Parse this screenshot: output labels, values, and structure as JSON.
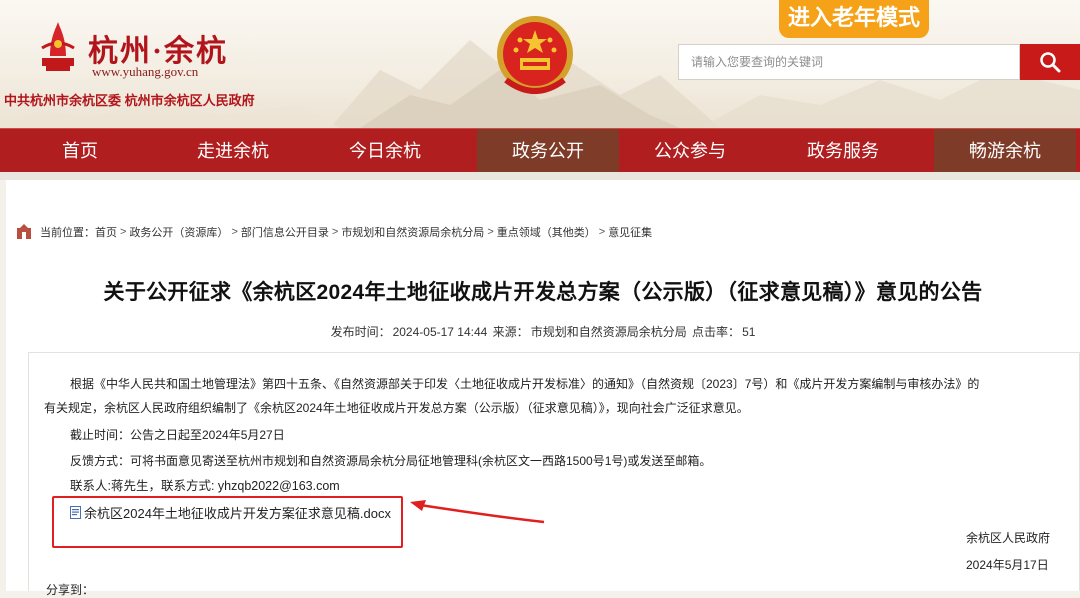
{
  "header": {
    "logo_title": "杭州·余杭",
    "logo_url": "www.yuhang.gov.cn",
    "logo_sub": "中共杭州市余杭区委 杭州市余杭区人民政府",
    "elder_mode": "进入老年模式",
    "search_placeholder": "请输入您要查询的关键词"
  },
  "nav": {
    "items": [
      "首页",
      "走进余杭",
      "今日余杭",
      "政务公开",
      "公众参与",
      "政务服务",
      "畅游余杭"
    ],
    "active": "政务公开"
  },
  "breadcrumb": {
    "prefix": "当前位置：",
    "items": [
      "首页",
      "政务公开（资源库）",
      "部门信息公开目录",
      "市规划和自然资源局余杭分局",
      "重点领域（其他类）",
      "意见征集"
    ],
    "separator": ">"
  },
  "article": {
    "title": "关于公开征求《余杭区2024年土地征收成片开发总方案（公示版）（征求意见稿）》意见的公告",
    "meta_publish_label": "发布时间：",
    "meta_publish_value": "2024-05-17 14:44",
    "meta_source_label": "来源：",
    "meta_source_value": "市规划和自然资源局余杭分局",
    "meta_clicks_label": "点击率：",
    "meta_clicks_value": "51",
    "para1_line1": "根据《中华人民共和国土地管理法》第四十五条、《自然资源部关于印发〈土地征收成片开发标准〉的通知》（自然资规〔2023〕7号）和《成片开发方案编制与审核办法》的",
    "para1_line2": "有关规定，余杭区人民政府组织编制了《余杭区2024年土地征收成片开发总方案（公示版）（征求意见稿）》，现向社会广泛征求意见。",
    "deadline": "截止时间：公告之日起至2024年5月27日",
    "feedback": "反馈方式：可将书面意见寄送至杭州市规划和自然资源局余杭分局征地管理科(余杭区文一西路1500号1号)或发送至邮箱。",
    "contact": "联系人:蒋先生，联系方式: yhzqb2022@163.com",
    "attachment": "余杭区2024年土地征收成片开发方案征求意见稿.docx",
    "sign_org": "余杭区人民政府",
    "sign_date": "2024年5月17日",
    "share": "分享到："
  },
  "colors": {
    "nav_red": "#b01e1f",
    "nav_active": "#7e3b28",
    "elder_orange": "#f5a219",
    "search_red": "#c91a1a",
    "annotation_red": "#e02020"
  }
}
